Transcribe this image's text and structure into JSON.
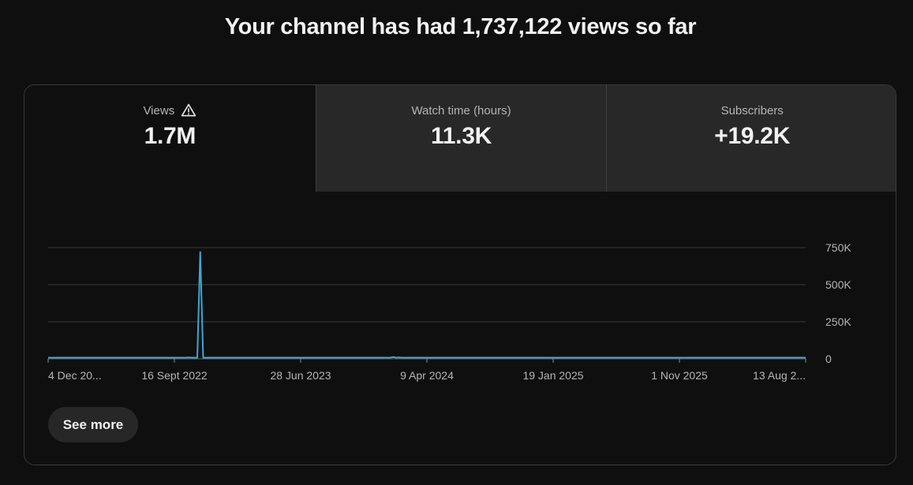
{
  "headline": "Your channel has had 1,737,122 views so far",
  "tabs": [
    {
      "label": "Views",
      "value": "1.7M",
      "active": true,
      "icon": "warning-icon"
    },
    {
      "label": "Watch time (hours)",
      "value": "11.3K",
      "active": false
    },
    {
      "label": "Subscribers",
      "value": "+19.2K",
      "active": false
    }
  ],
  "see_more_label": "See more",
  "colors": {
    "background": "#0f0f0f",
    "tab_inactive": "#282828",
    "line": "#3ea6d3",
    "grid": "#3a3a3a"
  },
  "chart_data": {
    "type": "line",
    "x_ticks": [
      "4 Dec 20...",
      "16 Sept 2022",
      "28 Jun 2023",
      "9 Apr 2024",
      "19 Jan 2025",
      "1 Nov 2025",
      "13 Aug 2..."
    ],
    "y_ticks": [
      "750K",
      "500K",
      "250K",
      "0"
    ],
    "ylim": [
      0,
      750000
    ],
    "grid": true,
    "series": [
      {
        "values": [
          0,
          0,
          0,
          0,
          0,
          0,
          0,
          0,
          0,
          0,
          0,
          0,
          0,
          0,
          0,
          0,
          0,
          0,
          0,
          0,
          0,
          0,
          6000,
          0,
          0,
          0,
          0,
          0,
          0,
          0,
          0,
          0,
          0,
          0,
          0,
          0,
          0,
          0,
          0,
          0,
          0,
          3000,
          0,
          0,
          5000,
          0,
          0,
          0,
          9000,
          0,
          0,
          4000,
          720000,
          0,
          0,
          5000,
          0,
          0,
          0,
          0,
          3000,
          0,
          0,
          0,
          0,
          0,
          0,
          0,
          0,
          0,
          0,
          0,
          0,
          0,
          0,
          0,
          0,
          0,
          0,
          0,
          0,
          0,
          0,
          0,
          0,
          0,
          0,
          0,
          0,
          0,
          0,
          0,
          0,
          0,
          0,
          0,
          0,
          0,
          5000,
          0,
          2000,
          0,
          0,
          4000,
          0,
          0,
          0,
          0,
          6000,
          0,
          3000,
          5000,
          0,
          7000,
          4000,
          0,
          8000,
          0,
          12000,
          5000,
          9000,
          0,
          6000,
          4000,
          7000,
          0,
          5000,
          0,
          3000,
          0,
          0,
          0,
          2000,
          0,
          0,
          0,
          0,
          0,
          0,
          0,
          0,
          0,
          0,
          0,
          0,
          0,
          0,
          0,
          0,
          0,
          0,
          0,
          0,
          0,
          0,
          0,
          0,
          0,
          0,
          0,
          0,
          0,
          0,
          0,
          0,
          0,
          0,
          0,
          0,
          0,
          0,
          0,
          0,
          0,
          0,
          0,
          0,
          0,
          0,
          0,
          0,
          0,
          0,
          0,
          0,
          0,
          0,
          0,
          0,
          0,
          0,
          0,
          0,
          0,
          0,
          0,
          0,
          0,
          0,
          0,
          0,
          0,
          0,
          0,
          0,
          0,
          0,
          0,
          0,
          0,
          0,
          0,
          0,
          0,
          0,
          0,
          0,
          0,
          0,
          0,
          0,
          0,
          0,
          0,
          0,
          0,
          0,
          0,
          0,
          0,
          0,
          0,
          0,
          0,
          0,
          0,
          0,
          0,
          0,
          0,
          0,
          0,
          0,
          0,
          0,
          0,
          0,
          0,
          0,
          0,
          0,
          0,
          0,
          0,
          0,
          0,
          0,
          0,
          0,
          0
        ]
      }
    ]
  }
}
